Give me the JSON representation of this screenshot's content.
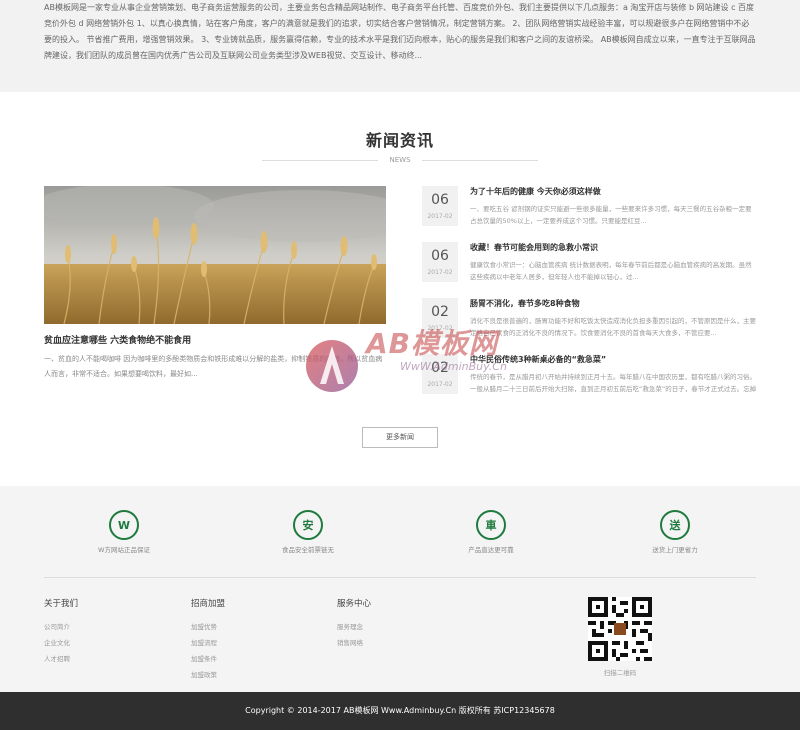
{
  "about": {
    "text": "AB模板网是一家专业从事企业营销策划、电子商务运营服务的公司，主要业务包含精品网站制作、电子商务平台托管、百度竞价外包、我们主要提供以下几点服务：a 淘宝开店与装修 b 网站建设 c 百度竞价外包 d 网络营销外包 1、以真心换真情，站在客户角度，客户的满意就是我们的追求，切实结合客户营销情况，制定营销方案。 2、团队网络营销实战经验丰富，可以规避很多户在网络营销中不必要的投入。 节省推广费用，增强营销效果。 3、专业铸就品质，服务赢得信赖，专业的技术水平是我们迈向根本，贴心的服务是我们和客户之间的友谊桥梁。 AB模板网自成立以来，一直专注于互联网品牌建设，我们团队的成员曾在国内优秀广告公司及互联网公司业务类型涉及WEB视觉、交互设计、移动终..."
  },
  "news_section": {
    "title": "新闻资讯",
    "subtitle": "NEWS"
  },
  "featured": {
    "title": "贫血应注意哪些 六类食物绝不能食用",
    "desc": "一、贫血的人不能喝咖啡 因为咖啡里的多酚类物质会和铁形成难以分解的盐类，抑制铁质的吸收，所以贫血病人而言，非常不适合。如果想要喝饮料，最好如..."
  },
  "news": [
    {
      "day": "06",
      "ym": "2017-02",
      "title": "为了十年后的健康 今天你必须这样做",
      "desc": "一、要吃五谷 谚剂钢的证实只能避一些很多能量，一些要来许多习惯，每天三餐的五谷杂粮一定要占总饮量的50%以上，一定要养成这个习惯。只要能是红豆..."
    },
    {
      "day": "06",
      "ym": "2017-02",
      "title": "收藏！春节可能会用到的急救小常识",
      "desc": "健康饮食小常识一：心脑血管疾病 统计数据表明，每年春节前后都是心脑血管疾病的高发期。虽然这些疾病以中老年人居多，但年轻人也不能掉以轻心，过..."
    },
    {
      "day": "02",
      "ym": "2017-02",
      "title": "肠胃不消化，春节多吃8种食物",
      "desc": "消化不良是很普遍的，肠胃功能不好和吃饭太快造成消化负担多重因引起的，不管原因是什么，主要定格自己饮食的正消化不良的情况下。饮食要消化不良的首食每天大食多，不管应要..."
    },
    {
      "day": "02",
      "ym": "2017-02",
      "title": "中华民俗传统3种新桌必备的“救急菜”",
      "desc": "传统的春节，是从腊月初八开始并持续到正月十五。每年腊八在中国农历里，都有吃腊八粥的习俗。一般从腊月二十三日前后开始大扫除，直到正月初五前后吃“救急菜”的日子，春节才正式过去。忘掉时间多吃不了多..."
    }
  ],
  "more_button": "更多新闻",
  "watermark": {
    "logo": "AB模板网",
    "url": "WwW.AdminBuy.Cn"
  },
  "services": [
    {
      "icon": "w-circle-icon",
      "glyph": "W",
      "label": "W方网站正品保证"
    },
    {
      "icon": "safe-icon",
      "glyph": "安",
      "label": "食品安全前票链无"
    },
    {
      "icon": "truck-icon",
      "glyph": "車",
      "label": "产品直达更可靠"
    },
    {
      "icon": "delivery-icon",
      "glyph": "送",
      "label": "送货上门更省力"
    }
  ],
  "footer_columns": [
    {
      "title": "关于我们",
      "links": [
        "公司简介",
        "企业文化",
        "人才招聘"
      ]
    },
    {
      "title": "招商加盟",
      "links": [
        "加盟优势",
        "加盟流程",
        "加盟条件",
        "加盟政策"
      ]
    },
    {
      "title": "服务中心",
      "links": [
        "服务理念",
        "销售网络"
      ]
    }
  ],
  "qr_label": "扫描二维码",
  "copyright": "Copyright © 2014-2017 AB模板网 Www.Adminbuy.Cn 版权所有    苏ICP12345678",
  "colors": {
    "accent_green": "#1e7a3e",
    "footer_bg": "#f4f4f4",
    "bottom_bar": "#2f2f2f"
  }
}
